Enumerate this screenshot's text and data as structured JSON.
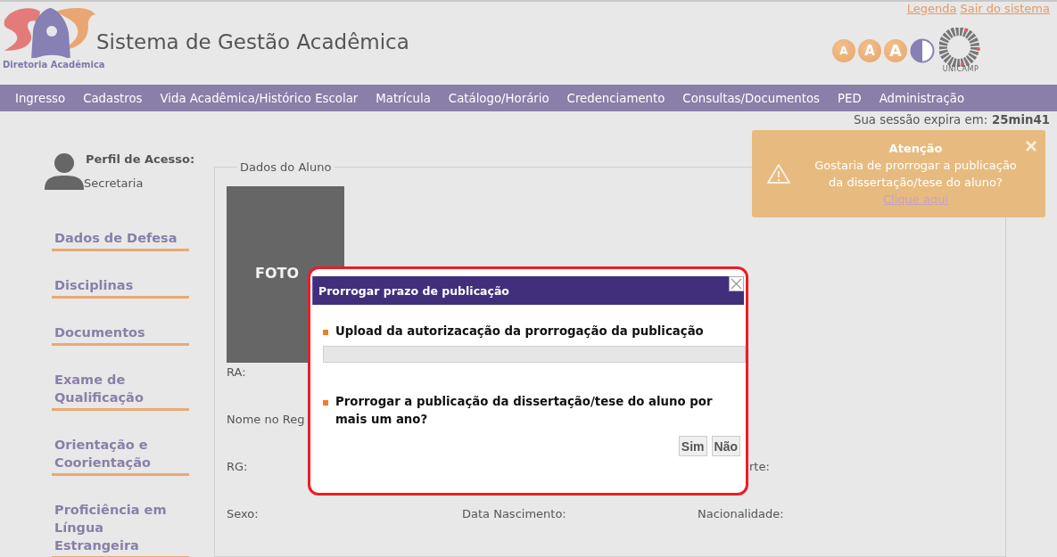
{
  "header": {
    "top_links": [
      "Legenda",
      "Sair do sistema"
    ],
    "logo_caption": "Diretoria Acadêmica",
    "title": "Sistema de Gestão Acadêmica",
    "font_size_buttons": [
      "A",
      "A",
      "A"
    ],
    "partner_logo_caption": "UNICAMP"
  },
  "nav": {
    "items": [
      "Ingresso",
      "Cadastros",
      "Vida Acadêmica/Histórico Escolar",
      "Matrícula",
      "Catálogo/Horário",
      "Credenciamento",
      "Consultas/Documentos",
      "PED",
      "Administração"
    ]
  },
  "session": {
    "label": "Sua sessão expira em:",
    "time": "25min41"
  },
  "profile": {
    "label": "Perfil de Acesso:",
    "value": "Secretaria"
  },
  "sidebar": {
    "items": [
      "Dados de Defesa",
      "Disciplinas",
      "Documentos",
      "Exame de Qualificação",
      "Orientação e Coorientação",
      "Proficiência em Língua Estrangeira"
    ]
  },
  "student_panel": {
    "legend": "Dados do Aluno",
    "photo_label": "FOTO",
    "field_rows": [
      {
        "col_1": "RA:"
      },
      {
        "col_1": "Nome no Reg"
      },
      {
        "col_1": "RG:",
        "col_3": "rte:"
      },
      {
        "col_1": "Sexo:",
        "col_2": "Data Nascimento:",
        "col_3": "Nacionalidade:"
      }
    ]
  },
  "toast": {
    "title": "Atenção",
    "message": "Gostaria de prorrogar a publicação da dissertação/tese do aluno?",
    "link": "Clique aqui"
  },
  "dialog": {
    "title": "Prorrogar prazo de publicação",
    "items": [
      {
        "kind": "upload",
        "label": "Upload da autorizacação da prorrogação da publicação"
      },
      {
        "kind": "question",
        "label": "Prorrogar a publicação da dissertação/tese do aluno por mais um ano?"
      }
    ],
    "buttons": [
      "Sim",
      "Não"
    ]
  }
}
